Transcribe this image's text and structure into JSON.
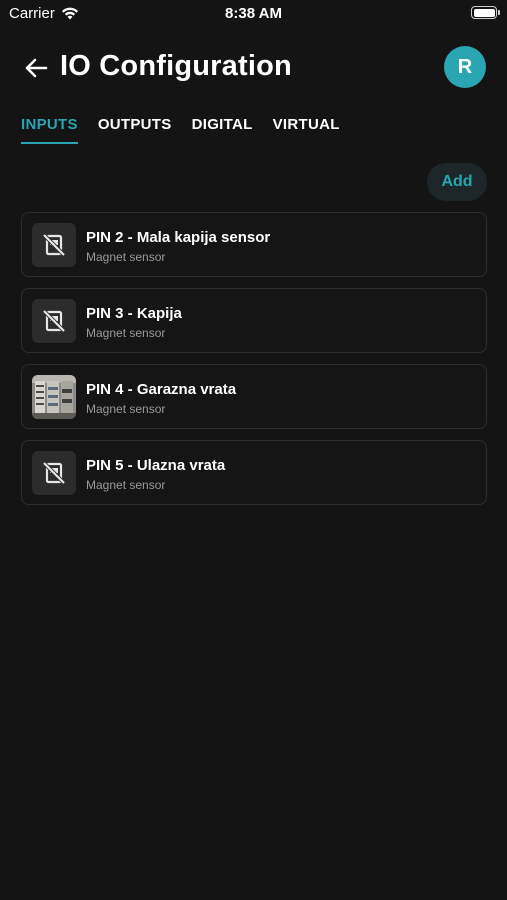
{
  "status_bar": {
    "carrier": "Carrier",
    "time": "8:38 AM",
    "wifi_icon": "wifi-icon",
    "battery_icon": "battery-icon"
  },
  "header": {
    "title": "IO Configuration",
    "back_icon": "arrow-left-icon",
    "avatar_initial": "R"
  },
  "tabs": [
    {
      "label": "INPUTS",
      "active": true
    },
    {
      "label": "OUTPUTS",
      "active": false
    },
    {
      "label": "DIGITAL",
      "active": false
    },
    {
      "label": "VIRTUAL",
      "active": false
    }
  ],
  "add_button": {
    "label": "Add"
  },
  "inputs": [
    {
      "name": "PIN 2 - Mala kapija sensor",
      "type": "Magnet sensor",
      "thumbnail": "no-image-icon"
    },
    {
      "name": "PIN 3 - Kapija",
      "type": "Magnet sensor",
      "thumbnail": "no-image-icon"
    },
    {
      "name": "PIN 4 - Garazna vrata",
      "type": "Magnet sensor",
      "thumbnail": "photo"
    },
    {
      "name": "PIN 5 - Ulazna vrata",
      "type": "Magnet sensor",
      "thumbnail": "no-image-icon"
    }
  ],
  "colors": {
    "background": "#141414",
    "accent": "#2aa6b3",
    "card_border": "#2e2e2e",
    "subtext": "#9a9a9a"
  }
}
